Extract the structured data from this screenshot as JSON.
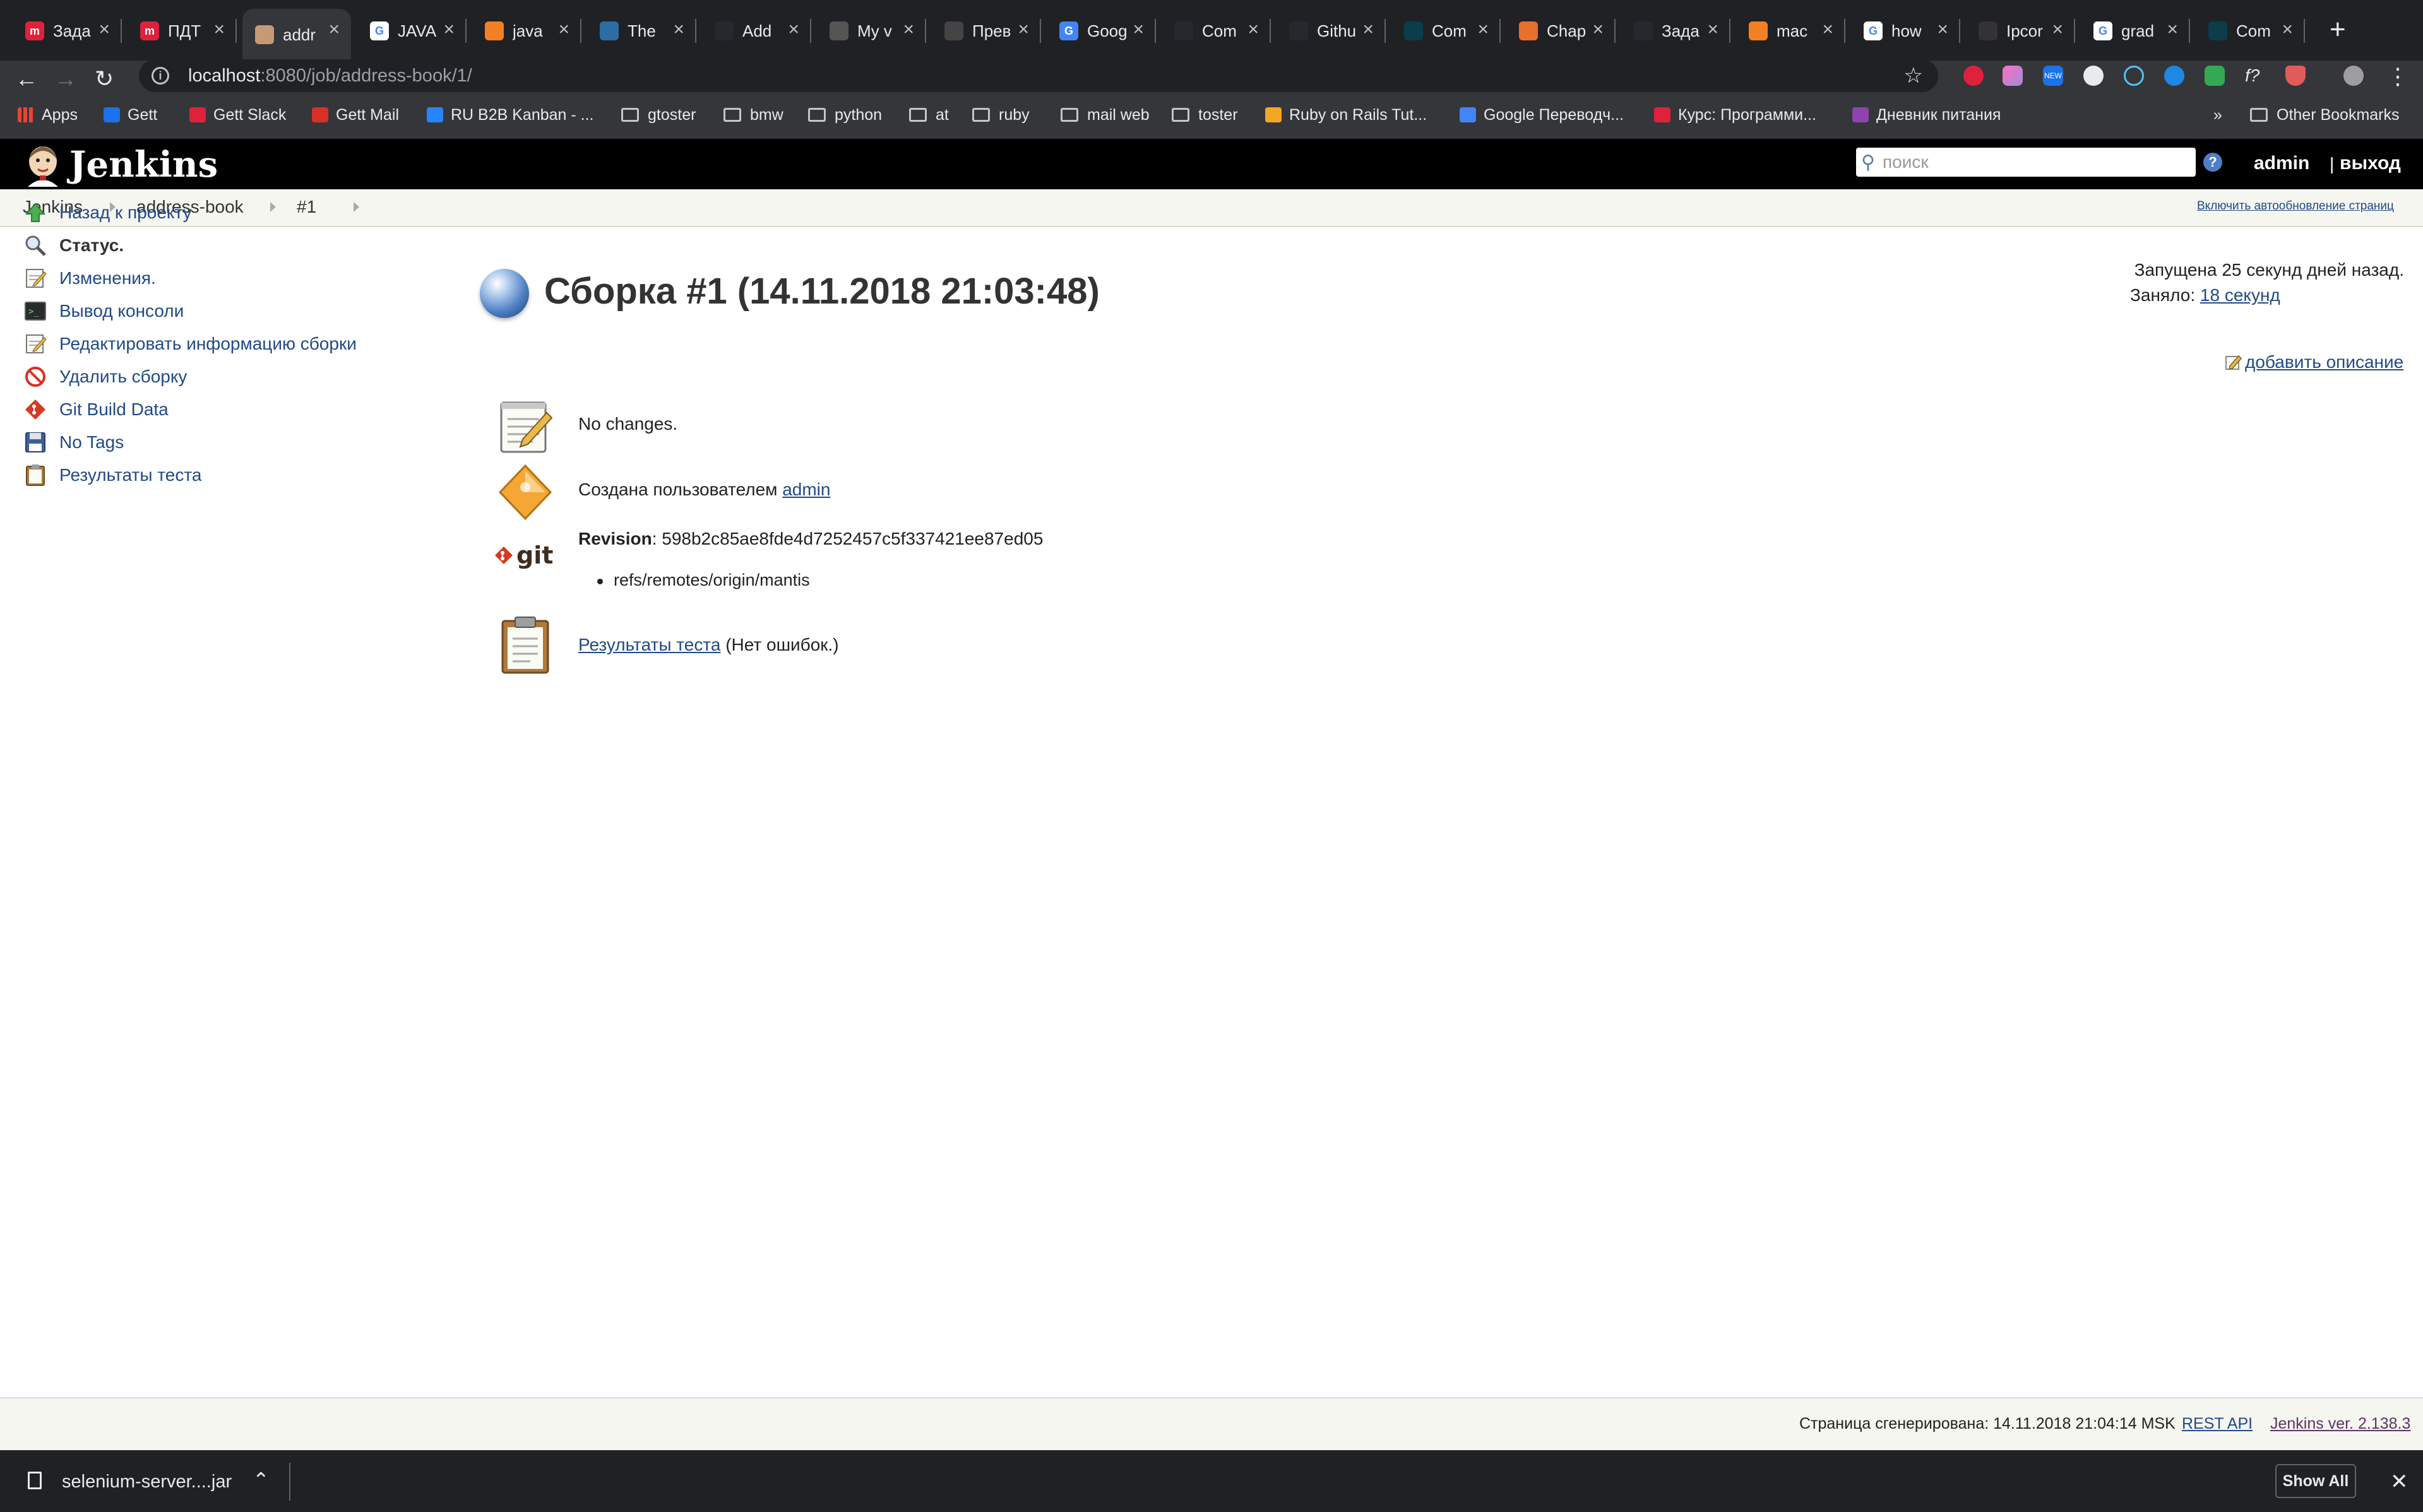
{
  "browser": {
    "tabs": [
      {
        "title": "Зада",
        "favicon_color": "#e0213c",
        "favicon_glyph": "m"
      },
      {
        "title": "ПДТ",
        "favicon_color": "#e0213c",
        "favicon_glyph": "m"
      },
      {
        "title": "addr",
        "favicon_color": "#c69a76",
        "favicon_glyph": "",
        "active": true
      },
      {
        "title": "JAVA",
        "favicon_color": "#ffffff",
        "favicon_glyph": "G"
      },
      {
        "title": "java",
        "favicon_color": "#f48024",
        "favicon_glyph": ""
      },
      {
        "title": "The",
        "favicon_color": "#2d6da3",
        "favicon_glyph": ""
      },
      {
        "title": "Add",
        "favicon_color": "#24292e",
        "favicon_glyph": ""
      },
      {
        "title": "My v",
        "favicon_color": "#555555",
        "favicon_glyph": ""
      },
      {
        "title": "Прев",
        "favicon_color": "#444444",
        "favicon_glyph": ""
      },
      {
        "title": "Goog",
        "favicon_color": "#4285f4",
        "favicon_glyph": "G"
      },
      {
        "title": "Com",
        "favicon_color": "#24292e",
        "favicon_glyph": ""
      },
      {
        "title": "Githu",
        "favicon_color": "#24292e",
        "favicon_glyph": ""
      },
      {
        "title": "Com",
        "favicon_color": "#0b3d4a",
        "favicon_glyph": ""
      },
      {
        "title": "Chap",
        "favicon_color": "#e86f2c",
        "favicon_glyph": ""
      },
      {
        "title": "Зада",
        "favicon_color": "#24292e",
        "favicon_glyph": ""
      },
      {
        "title": "mac",
        "favicon_color": "#f48024",
        "favicon_glyph": ""
      },
      {
        "title": "how",
        "favicon_color": "#ffffff",
        "favicon_glyph": "G"
      },
      {
        "title": "Ipcor",
        "favicon_color": "#333333",
        "favicon_glyph": ""
      },
      {
        "title": "grad",
        "favicon_color": "#ffffff",
        "favicon_glyph": "G"
      },
      {
        "title": "Com",
        "favicon_color": "#0b3d4a",
        "favicon_glyph": ""
      }
    ],
    "url_host": "localhost",
    "url_path": ":8080/job/address-book/1/",
    "bookmarks": [
      {
        "label": "Apps",
        "kind": "apps",
        "color": "#4285f4"
      },
      {
        "label": "Gett",
        "kind": "site",
        "color": "#1a73e8"
      },
      {
        "label": "Gett Slack",
        "kind": "site",
        "color": "#e0213c"
      },
      {
        "label": "Gett Mail",
        "kind": "site",
        "color": "#d93025"
      },
      {
        "label": "RU B2B Kanban - ...",
        "kind": "site",
        "color": "#2684ff"
      },
      {
        "label": "gtoster",
        "kind": "folder"
      },
      {
        "label": "bmw",
        "kind": "folder"
      },
      {
        "label": "python",
        "kind": "folder"
      },
      {
        "label": "at",
        "kind": "folder"
      },
      {
        "label": "ruby",
        "kind": "folder"
      },
      {
        "label": "mail web",
        "kind": "folder"
      },
      {
        "label": "toster",
        "kind": "folder"
      },
      {
        "label": "Ruby on Rails Tut...",
        "kind": "site",
        "color": "#f5a623"
      },
      {
        "label": "Google Переводч...",
        "kind": "site",
        "color": "#4285f4"
      },
      {
        "label": "Курс: Программи...",
        "kind": "site",
        "color": "#e0213c"
      },
      {
        "label": "Дневник питания",
        "kind": "site",
        "color": "#8e44ad"
      }
    ],
    "bookmarks_overflow": "»",
    "other_bookmarks": "Other Bookmarks"
  },
  "jenkins": {
    "title": "Jenkins",
    "search_placeholder": "поиск",
    "help": "?",
    "user": "admin",
    "logout": "выход",
    "breadcrumbs": [
      "Jenkins",
      "address-book",
      "#1"
    ],
    "autorefresh": "Включить автообновление страниц",
    "side_items": [
      {
        "label": "Назад к проекту",
        "icon": "up-arrow-icon"
      },
      {
        "label": "Статус.",
        "icon": "magnifier-icon",
        "current": true
      },
      {
        "label": "Изменения.",
        "icon": "notepad-icon"
      },
      {
        "label": "Вывод консоли",
        "icon": "terminal-icon"
      },
      {
        "label": "Редактировать информацию сборки",
        "icon": "notepad-icon"
      },
      {
        "label": "Удалить сборку",
        "icon": "no-entry-icon"
      },
      {
        "label": "Git Build Data",
        "icon": "git-icon"
      },
      {
        "label": "No Tags",
        "icon": "floppy-disk-icon"
      },
      {
        "label": "Результаты теста",
        "icon": "clipboard-icon"
      }
    ],
    "build_title": "Сборка #1 (14.11.2018 21:03:48)",
    "started": "Запущена 25 секунд дней назад.",
    "took_label": "Заняло:",
    "took_value": "18 секунд",
    "add_description": "добавить описание",
    "no_changes": "No changes.",
    "created_by": "Создана пользователем",
    "created_user": "admin",
    "revision_label": "Revision",
    "revision_value": ": 598b2c85ae8fde4d7252457c5f337421ee87ed05",
    "branch": "refs/remotes/origin/mantis",
    "test_results_link": "Результаты теста",
    "test_results_note": " (Нет ошибок.)",
    "git_logo_text": "git",
    "footer_generated": "Страница сгенерирована: 14.11.2018 21:04:14 MSK",
    "footer_rest": "REST API",
    "footer_version": "Jenkins ver. 2.138.3"
  },
  "downloads": {
    "file": "selenium-server....jar",
    "show_all": "Show All"
  }
}
